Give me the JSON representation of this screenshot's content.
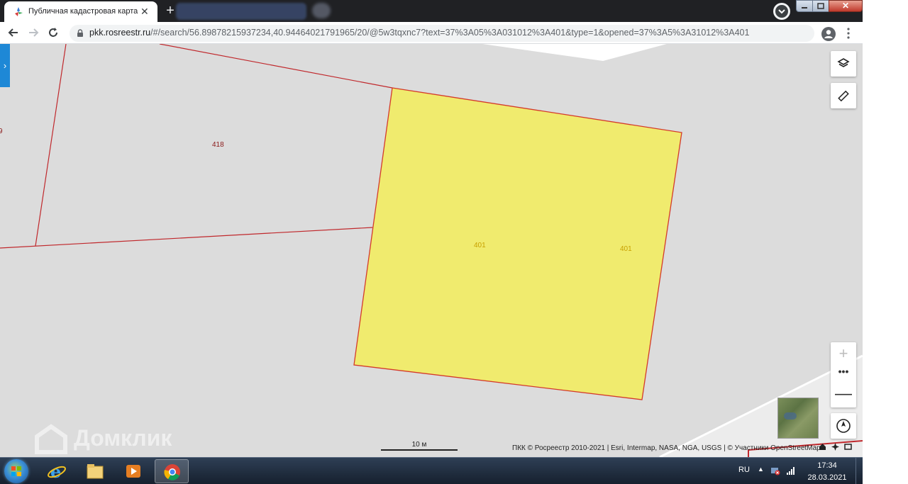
{
  "browser": {
    "active_tab": {
      "title": "Публичная кадастровая карта",
      "favicon": "rosreestr-favicon"
    },
    "new_tab_label": "+",
    "tab_close_label": "✕",
    "url_host": "pkk.rosreestr.ru",
    "url_path": "/#/search/56.89878215937234,40.94464021791965/20/@5w3tqxnc7?text=37%3A05%3A031012%3A401&type=1&opened=37%3A5%3A31012%3A401",
    "window_controls": {
      "close_label": "✕"
    }
  },
  "map": {
    "parcels": [
      {
        "label": "418",
        "color": "#8b1a1a"
      },
      {
        "label": "401",
        "color": "#c8a000"
      },
      {
        "label": "401",
        "color": "#c8a000"
      }
    ],
    "edge_label": "9",
    "selected_fill": "#f0eb6e",
    "boundary_color": "#c0282c",
    "scale_label": "10 м",
    "attribution": "ПКК © Росреестр 2010-2021 | Esri, Intermap, NASA, NGA, USGS | © Участники OpenStreetMap",
    "panel_toggle_label": "›",
    "zoom": {
      "in_label": "+",
      "more_label": "•••",
      "out_label": "—"
    },
    "watermark": "Домклик"
  },
  "taskbar": {
    "language": "RU",
    "tray_arrow": "▲",
    "time": "17:34",
    "date": "28.03.2021",
    "apps": [
      "start-orb",
      "ie-icon",
      "explorer-icon",
      "media-player-icon",
      "chrome-icon"
    ]
  }
}
